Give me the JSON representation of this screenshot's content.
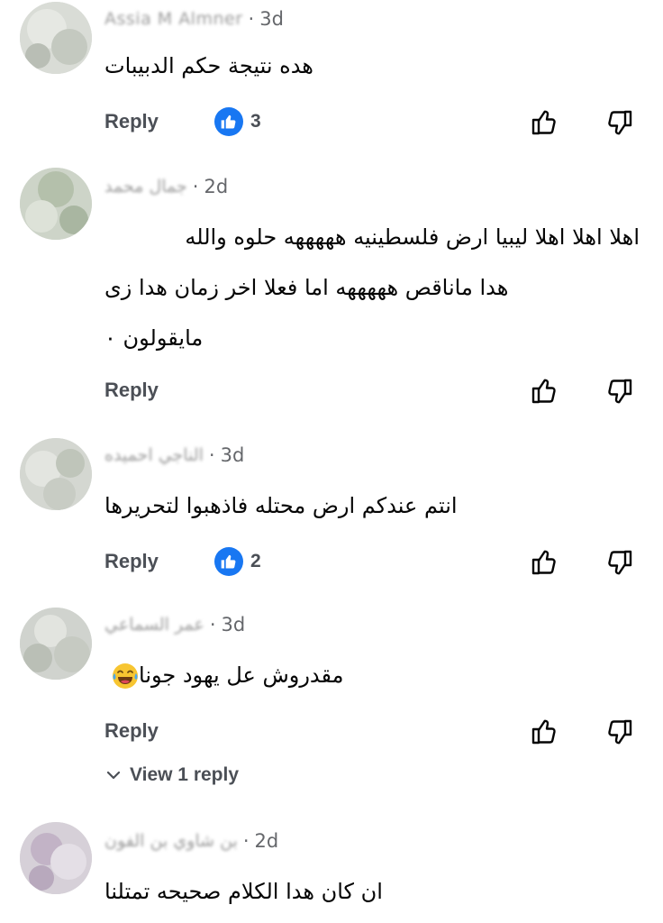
{
  "comments": [
    {
      "author": "Assia M Almner",
      "time": "3d",
      "lines": [
        "هده نتيجة حكم الدبيبات"
      ],
      "reply_label": "Reply",
      "likes": "3",
      "avatar_tone": "#cfd3cc"
    },
    {
      "author": "جمال محمد",
      "time": "2d",
      "lines": [
        "اهلا اهلا اهلا  ليبيا ارض فلسطينيه  هههههه  حلوه والله",
        "هدا ماناقص  هههههه  اما فعلا اخر زمان  هدا زى",
        "مايقولون ٠"
      ],
      "reply_label": "Reply",
      "likes": "",
      "avatar_tone": "#c7cfc2"
    },
    {
      "author": "الناجي احميده",
      "time": "3d",
      "lines": [
        "انتم عندكم ارض محتله فاذهبوا لتحريرها"
      ],
      "reply_label": "Reply",
      "likes": "2",
      "avatar_tone": "#d2d5cf"
    },
    {
      "author": "عمر السماعي",
      "time": "3d",
      "lines": [
        "مقدروش عل يهود جونا"
      ],
      "emoji": "face-with-tears-of-joy",
      "reply_label": "Reply",
      "likes": "",
      "view_replies": "View 1 reply",
      "avatar_tone": "#cdd0cb"
    },
    {
      "author": "بن شاوي بن الفون",
      "time": "2d",
      "lines": [
        "ان كان هدا الكلام صحيحه تمتلنا"
      ],
      "avatar_tone": "#d5cdd6"
    }
  ],
  "icons": {
    "like": "thumbs-up-outline",
    "dislike": "thumbs-down-outline",
    "reaction": "like-reaction-badge",
    "expand": "chevron-down"
  },
  "colors": {
    "text": "#050505",
    "secondary": "#65676b",
    "action": "#4b4f56",
    "like_blue": "#1877f2"
  }
}
